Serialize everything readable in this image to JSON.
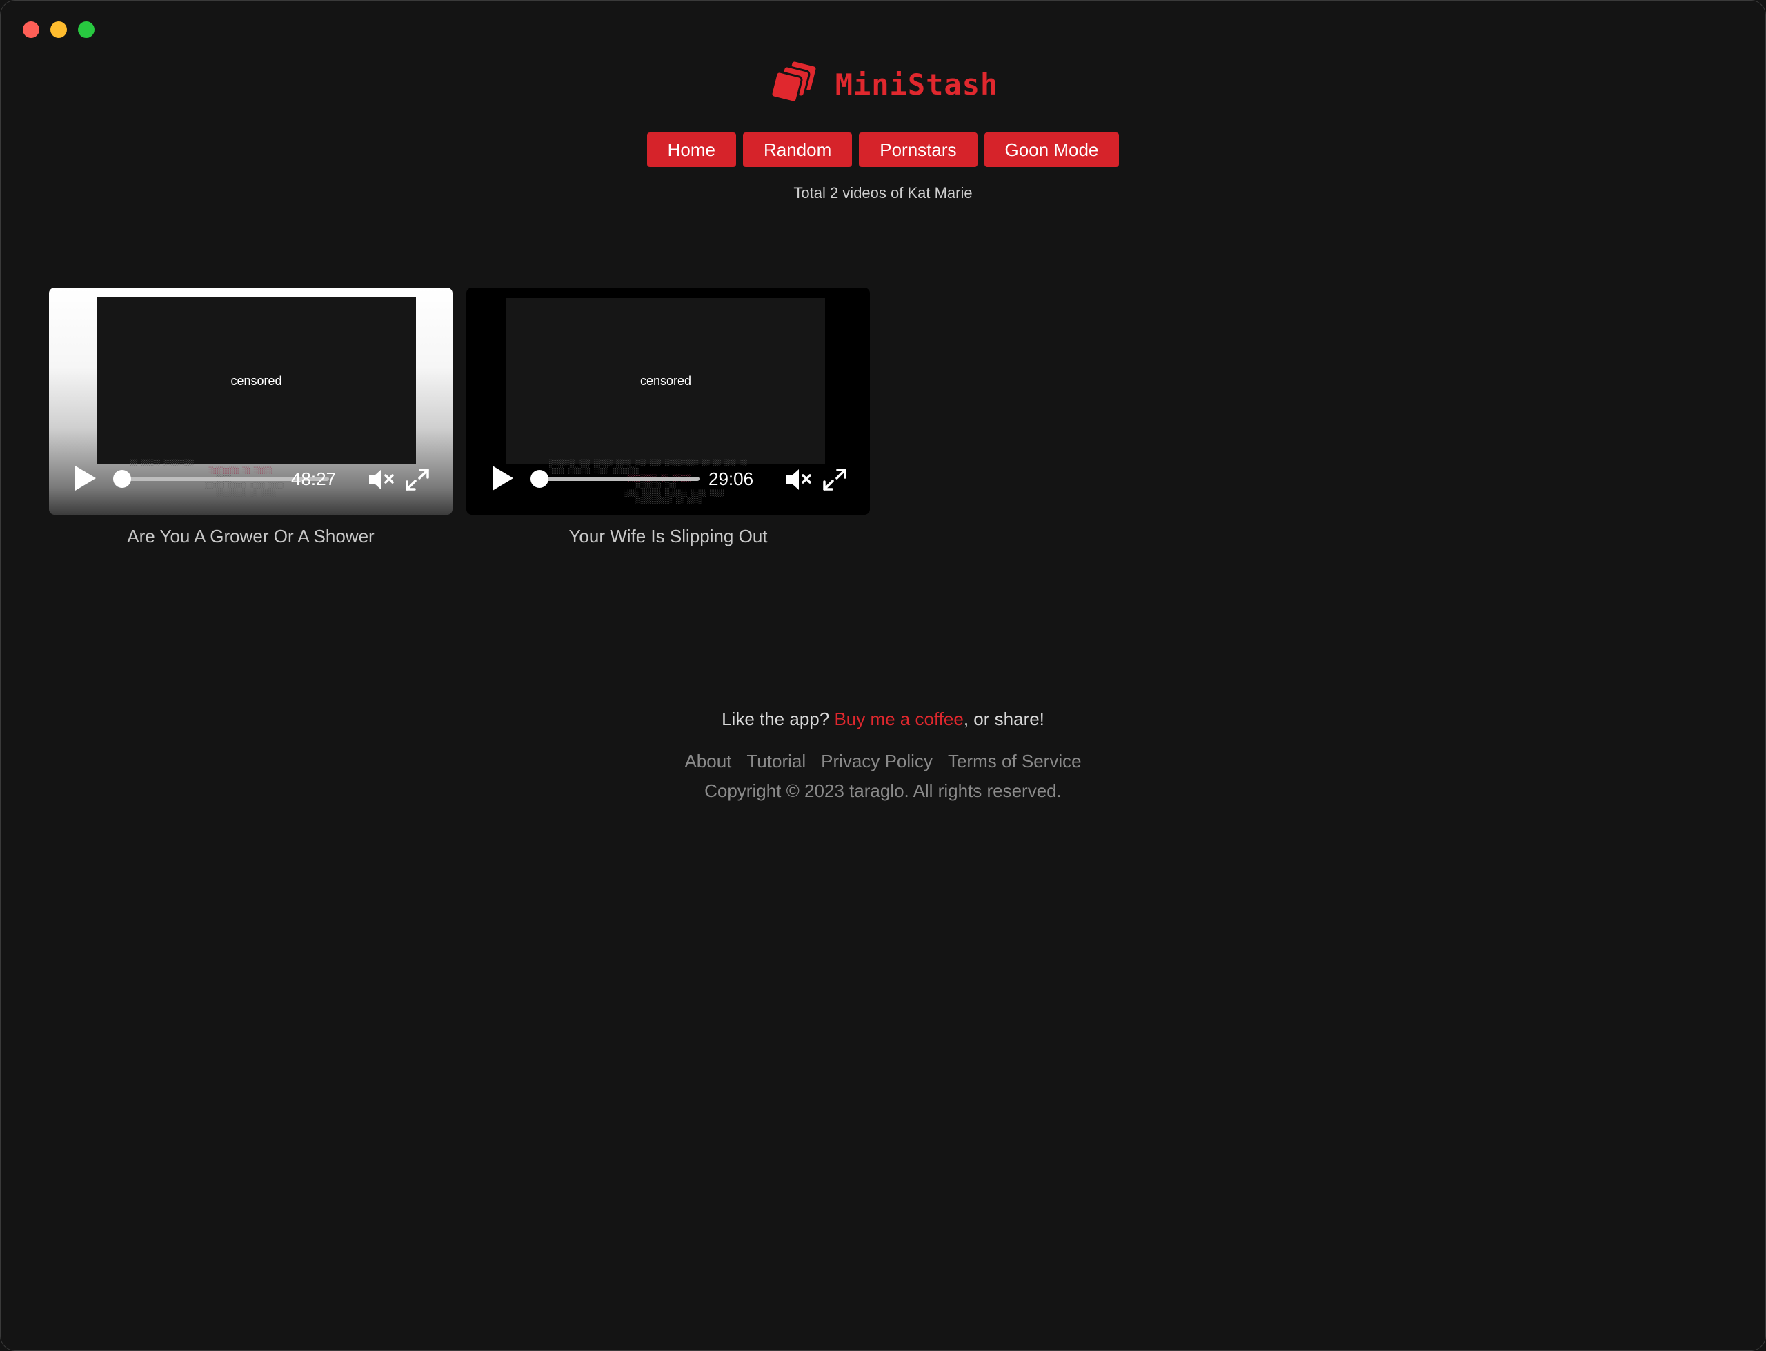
{
  "window": {
    "controls": [
      "close",
      "minimize",
      "maximize"
    ]
  },
  "brand": {
    "name": "MiniStash",
    "logo_icon": "stacked-cards-icon",
    "color": "#e0282e"
  },
  "nav": {
    "items": [
      "Home",
      "Random",
      "Pornstars",
      "Goon Mode"
    ]
  },
  "summary": {
    "text": "Total 2 videos of Kat Marie"
  },
  "videos": [
    {
      "title": "Are You A Grower Or A Shower",
      "overlay": "censored",
      "duration": "48:27",
      "progress": 0.0,
      "muted": true
    },
    {
      "title": "Your Wife Is Slipping Out",
      "overlay": "censored",
      "duration": "29:06",
      "progress": 0.0,
      "muted": true
    }
  ],
  "footer": {
    "like_prefix": "Like the app? ",
    "coffee_link": "Buy me a coffee",
    "like_suffix": ", or share!",
    "links": [
      "About",
      "Tutorial",
      "Privacy Policy",
      "Terms of Service"
    ],
    "copyright": "Copyright © 2023 taraglo. All rights reserved."
  }
}
